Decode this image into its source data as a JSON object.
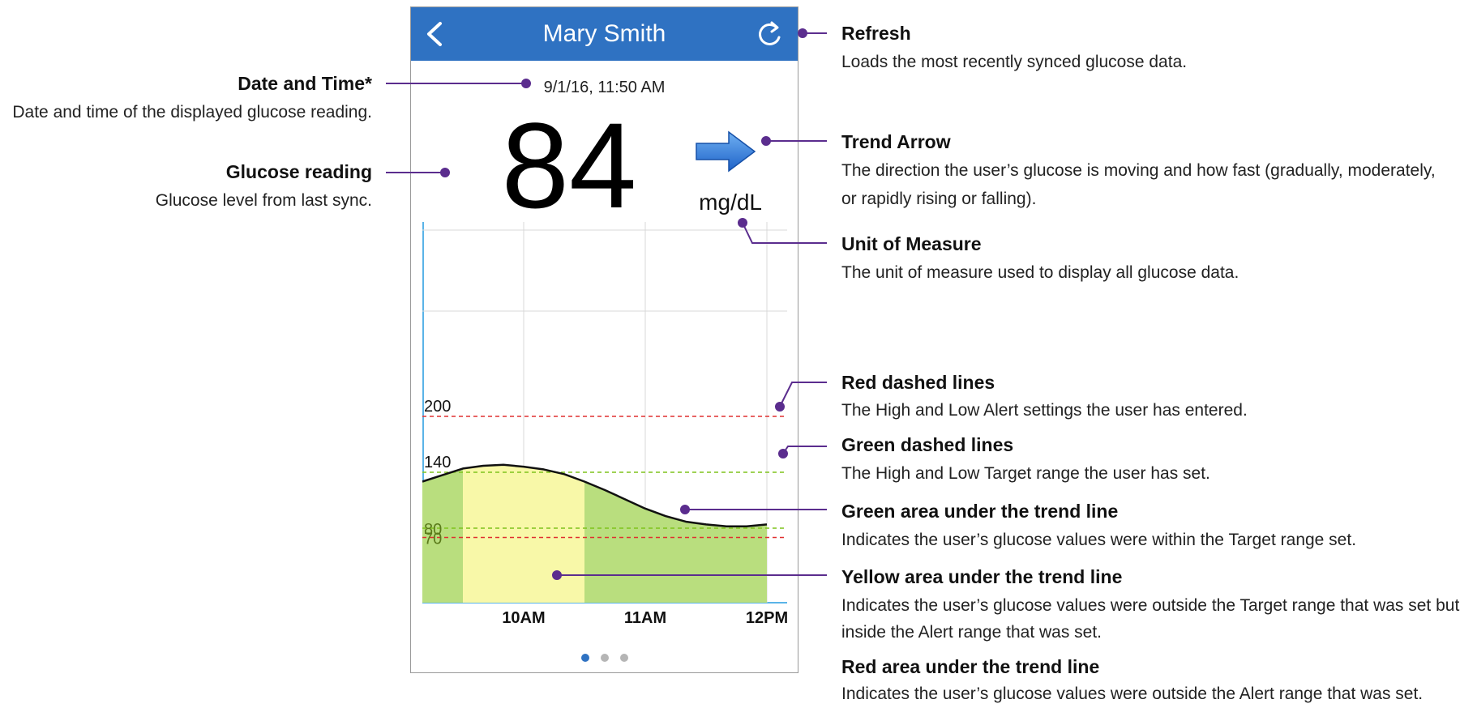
{
  "app": {
    "header_title": "Mary Smith",
    "datetime": "9/1/16, 11:50 AM",
    "glucose_value": "84",
    "unit": "mg/dL",
    "trend_direction": "steady",
    "pager": {
      "pages": 3,
      "active": 1
    },
    "colors": {
      "header": "#2f72c2",
      "target_area": "#b9de7e",
      "alert_area": "#f8f8a8",
      "alert_line": "#e03030",
      "target_line": "#7fc31c",
      "accent": "#5b2d8e"
    }
  },
  "chart_data": {
    "type": "area",
    "x_ticks": [
      "10AM",
      "11AM",
      "12PM"
    ],
    "y_labels": [
      "200",
      "140",
      "80",
      "70"
    ],
    "alert_lines": [
      200,
      70
    ],
    "target_lines": [
      140,
      80
    ],
    "y_range": [
      0,
      400
    ],
    "grid": true,
    "x": [
      "9:00",
      "9:10",
      "9:20",
      "9:30",
      "9:40",
      "9:50",
      "10:00",
      "10:10",
      "10:20",
      "10:30",
      "10:40",
      "10:50",
      "11:00",
      "11:10",
      "11:20",
      "11:30",
      "11:40",
      "11:50"
    ],
    "values": [
      130,
      137,
      144,
      147,
      148,
      146,
      143,
      138,
      130,
      121,
      111,
      101,
      93,
      87,
      84,
      82,
      82,
      84
    ],
    "segments": [
      {
        "from": "9:00",
        "to": "9:20",
        "zone": "target"
      },
      {
        "from": "9:20",
        "to": "10:20",
        "zone": "alert"
      },
      {
        "from": "10:20",
        "to": "11:50",
        "zone": "target"
      }
    ]
  },
  "callouts": {
    "refresh": {
      "title": "Refresh",
      "desc": "Loads the most recently synced glucose data."
    },
    "datetime": {
      "title": "Date and Time*",
      "desc": "Date and time of the displayed glucose reading."
    },
    "glucose": {
      "title": "Glucose reading",
      "desc": "Glucose level from last sync."
    },
    "trend": {
      "title": "Trend Arrow",
      "desc1": "The direction the user’s glucose is moving and how fast (gradually, moderately,",
      "desc2": "or rapidly rising or falling)."
    },
    "unit": {
      "title": "Unit of Measure",
      "desc": "The unit of measure used to display all glucose data."
    },
    "red_dashed": {
      "title": "Red dashed lines",
      "desc": "The High and Low Alert settings the user has entered."
    },
    "green_dashed": {
      "title": "Green dashed lines",
      "desc": "The High and Low Target range the user has set."
    },
    "green_area": {
      "title": "Green area under the trend line",
      "desc": "Indicates the user’s glucose values were within the Target range set."
    },
    "yellow_area": {
      "title": "Yellow area under the trend line",
      "desc1": "Indicates the user’s glucose values were outside the Target range that was set but",
      "desc2": "inside the Alert range that was set."
    },
    "red_area": {
      "title": "Red area under the trend line",
      "desc": "Indicates the user’s glucose values were outside the Alert range that was set."
    }
  }
}
